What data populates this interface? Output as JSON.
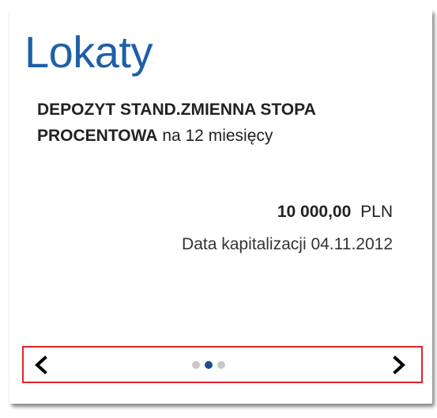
{
  "card": {
    "title": "Lokaty",
    "product_name": "DEPOZYT STAND.ZMIENNA STOPA PROCENTOWA",
    "product_term": "na 12 miesięcy",
    "amount": "10 000,00",
    "currency": "PLN",
    "capitalization_label": "Data kapitalizacji",
    "capitalization_date": "04.11.2012"
  },
  "carousel": {
    "prev_icon": "chevron-left-icon",
    "next_icon": "chevron-right-icon",
    "page_count": 3,
    "active_page": 2
  },
  "colors": {
    "title": "#1f5fa8",
    "text": "#222222",
    "highlight_border": "#e3232c",
    "dot_active": "#1f4f8f",
    "dot_inactive": "#c7c7c7"
  }
}
